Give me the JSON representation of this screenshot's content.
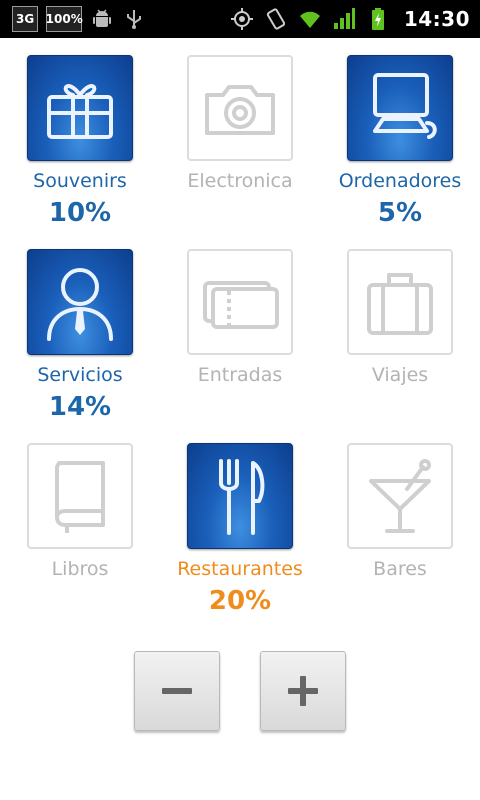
{
  "statusbar": {
    "network_label": "3G",
    "battery_label": "100%",
    "time": "14:30",
    "icons": [
      "network-3g-icon",
      "battery-percent-icon",
      "android-debug-icon",
      "usb-icon",
      "gps-icon",
      "vibrate-icon",
      "wifi-icon",
      "signal-icon",
      "battery-charging-icon"
    ]
  },
  "categories": [
    {
      "label": "Souvenirs",
      "percent": "10%",
      "state": "active",
      "icon": "gift-icon"
    },
    {
      "label": "Electronica",
      "percent": "",
      "state": "inactive",
      "icon": "camera-icon"
    },
    {
      "label": "Ordenadores",
      "percent": "5%",
      "state": "active",
      "icon": "computer-icon"
    },
    {
      "label": "Servicios",
      "percent": "14%",
      "state": "active",
      "icon": "person-icon"
    },
    {
      "label": "Entradas",
      "percent": "",
      "state": "inactive",
      "icon": "ticket-icon"
    },
    {
      "label": "Viajes",
      "percent": "",
      "state": "inactive",
      "icon": "suitcase-icon"
    },
    {
      "label": "Libros",
      "percent": "",
      "state": "inactive",
      "icon": "book-icon"
    },
    {
      "label": "Restaurantes",
      "percent": "20%",
      "state": "highlight",
      "icon": "cutlery-icon"
    },
    {
      "label": "Bares",
      "percent": "",
      "state": "inactive",
      "icon": "cocktail-icon"
    }
  ],
  "controls": {
    "zoom_out_icon": "minus-icon",
    "zoom_in_icon": "plus-icon"
  },
  "colors": {
    "active_text": "#1d66a9",
    "highlight_text": "#f08c1c",
    "inactive_text": "#b3b3b3",
    "tile_blue": "#1a5fba"
  }
}
